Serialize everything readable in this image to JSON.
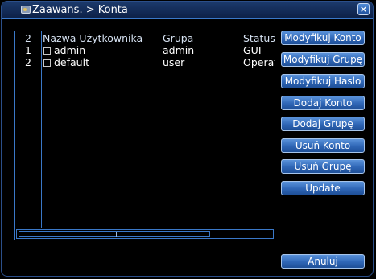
{
  "window": {
    "title": "Zaawans. > Konta",
    "close_label": "×"
  },
  "list": {
    "headers": {
      "num": "2",
      "name": "Nazwa Użytkownika",
      "group": "Grupa",
      "status": "Status"
    },
    "rows": [
      {
        "num": "1",
        "name": "admin",
        "group": "admin",
        "status": "GUI"
      },
      {
        "num": "2",
        "name": "default",
        "group": "user",
        "status": "Operat"
      }
    ]
  },
  "buttons": {
    "modify_account": "Modyfikuj Konto",
    "modify_group": "Modyfikuj Grupę",
    "modify_password": "Modyfikuj Haslo",
    "add_account": "Dodaj Konto",
    "add_group": "Dodaj Grupę",
    "delete_account": "Usuń Konto",
    "delete_group": "Usuń Grupę",
    "update": "Update",
    "cancel": "Anuluj"
  },
  "colors": {
    "accent": "#3a78c8",
    "button": "#2f66b6",
    "background": "#000000"
  }
}
